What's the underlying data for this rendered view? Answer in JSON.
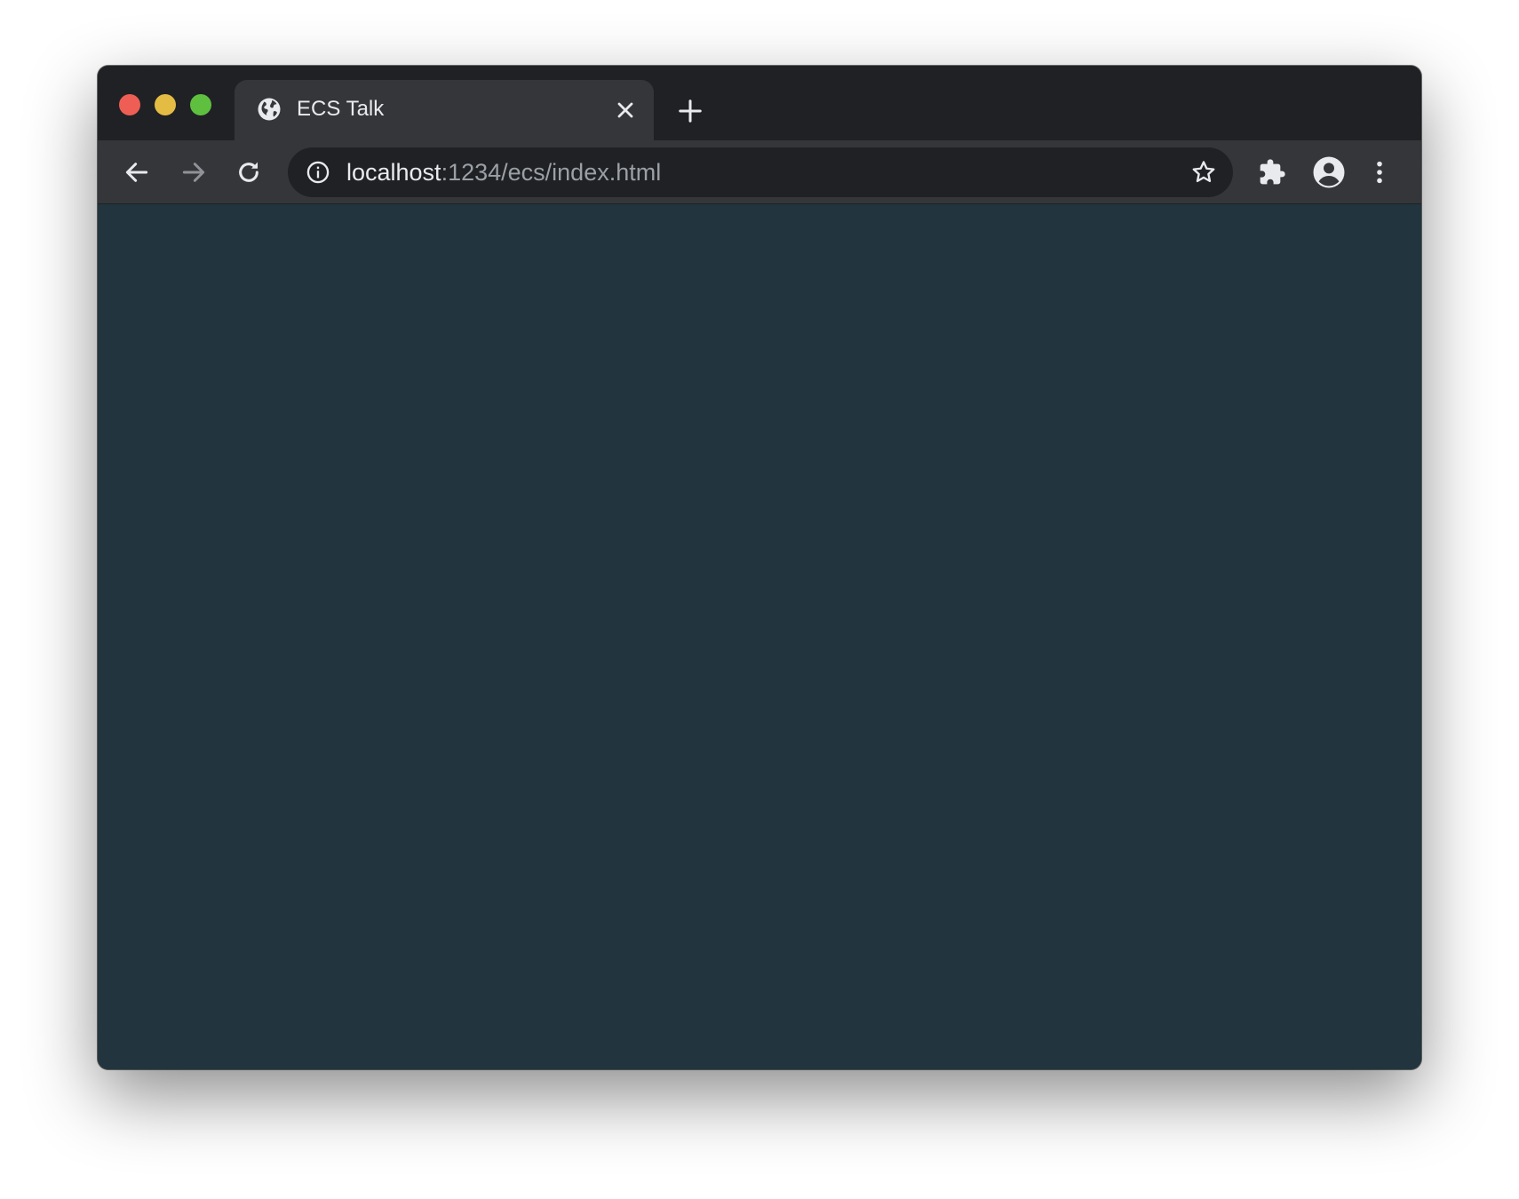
{
  "window": {
    "traffic_lights": {
      "close_color": "#ee5e55",
      "minimize_color": "#e4bc44",
      "maximize_color": "#5fc040"
    }
  },
  "tabs": [
    {
      "title": "ECS Talk",
      "icon": "globe-icon",
      "active": true
    }
  ],
  "toolbar": {
    "address": {
      "host": "localhost",
      "rest": ":1234/ecs/index.html"
    }
  },
  "content": {
    "background_color": "#22353e"
  }
}
